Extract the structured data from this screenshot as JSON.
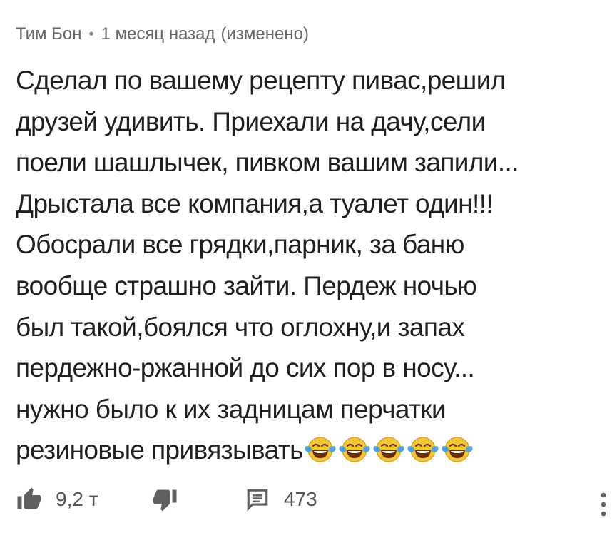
{
  "comment": {
    "author": "Тим Бон",
    "separator": "•",
    "time": "1 месяц назад",
    "edited": "(изменено)",
    "lines": [
      "Сделал по вашему рецепту пивас,решил",
      "друзей удивить. Приехали на дачу,сели",
      "поели шашлычек, пивком вашим запили...",
      "Дрыстала все компания,а туалет один!!!",
      "Обосрали все грядки,парник, за баню",
      "вообще страшно зайти. Пердеж ночью",
      "был такой,боялся что оглохну,и запах",
      "пердежно-ржанной до сих пор в носу...",
      "нужно было  к их задницам перчатки",
      "резиновые привязывать"
    ],
    "emoji_icon": "face-with-tears-of-joy-icon",
    "emoji_count": 5
  },
  "actions": {
    "likes": "9,2 т",
    "replies": "473",
    "like_icon": "thumbs-up-icon",
    "dislike_icon": "thumbs-down-icon",
    "reply_icon": "comment-icon",
    "menu_icon": "more-vertical-icon"
  },
  "colors": {
    "text": "#1f1f1f",
    "meta": "#666666",
    "icon": "#606060",
    "emoji_face": "#F7C531",
    "emoji_tear": "#4FA3E0"
  }
}
